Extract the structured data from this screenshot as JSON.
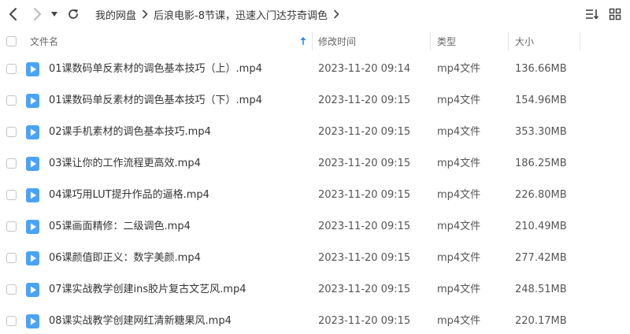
{
  "breadcrumb": {
    "items": [
      "我的网盘",
      "后浪电影-8节课，迅速入门达芬奇调色"
    ]
  },
  "columns": {
    "name": "文件名",
    "modified": "修改时间",
    "type": "类型",
    "size": "大小"
  },
  "colors": {
    "accent": "#2f8bf2",
    "video_icon": "#4aa4f5"
  },
  "icons": {
    "back": "chevron-left-icon",
    "forward": "chevron-right-icon",
    "history": "caret-down-icon",
    "refresh": "refresh-icon",
    "sort": "sort-icon",
    "view": "grid-view-icon",
    "file": "video-file-icon"
  },
  "files": [
    {
      "name": "01课数码单反素材的调色基本技巧（上）.mp4",
      "modified": "2023-11-20 09:14",
      "type": "mp4文件",
      "size": "136.66MB"
    },
    {
      "name": "01课数码单反素材的调色基本技巧（下）.mp4",
      "modified": "2023-11-20 09:15",
      "type": "mp4文件",
      "size": "154.96MB"
    },
    {
      "name": "02课手机素材的调色基本技巧.mp4",
      "modified": "2023-11-20 09:15",
      "type": "mp4文件",
      "size": "353.30MB"
    },
    {
      "name": "03课让你的工作流程更高效.mp4",
      "modified": "2023-11-20 09:15",
      "type": "mp4文件",
      "size": "186.25MB"
    },
    {
      "name": "04课巧用LUT提升作品的逼格.mp4",
      "modified": "2023-11-20 09:15",
      "type": "mp4文件",
      "size": "226.80MB"
    },
    {
      "name": "05课画面精修：二级调色.mp4",
      "modified": "2023-11-20 09:15",
      "type": "mp4文件",
      "size": "210.49MB"
    },
    {
      "name": "06课颜值即正义：数字美颜.mp4",
      "modified": "2023-11-20 09:15",
      "type": "mp4文件",
      "size": "277.42MB"
    },
    {
      "name": "07课实战教学创建ins胶片复古文艺风.mp4",
      "modified": "2023-11-20 09:15",
      "type": "mp4文件",
      "size": "248.51MB"
    },
    {
      "name": "08课实战教学创建网红清新糖果风.mp4",
      "modified": "2023-11-20 09:15",
      "type": "mp4文件",
      "size": "220.17MB"
    }
  ]
}
